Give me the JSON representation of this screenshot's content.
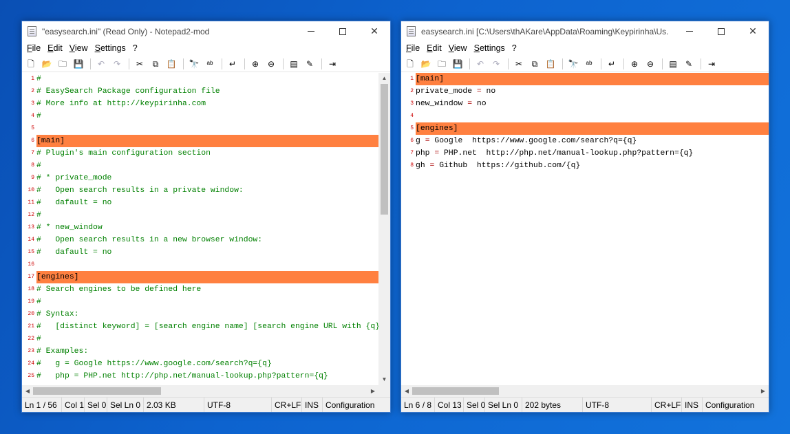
{
  "left": {
    "title": "\"easysearch.ini\" (Read Only) - Notepad2-mod",
    "menu": [
      "File",
      "Edit",
      "View",
      "Settings",
      "?"
    ],
    "lines": [
      {
        "n": "1",
        "t": "#",
        "k": "c"
      },
      {
        "n": "2",
        "t": "# EasySearch Package configuration file",
        "k": "c"
      },
      {
        "n": "3",
        "t": "# More info at http://keypirinha.com",
        "k": "c"
      },
      {
        "n": "4",
        "t": "#",
        "k": "c"
      },
      {
        "n": "5",
        "t": "",
        "k": "c"
      },
      {
        "n": "6",
        "t": "[main]",
        "k": "h"
      },
      {
        "n": "7",
        "t": "# Plugin's main configuration section",
        "k": "c"
      },
      {
        "n": "8",
        "t": "#",
        "k": "c"
      },
      {
        "n": "9",
        "t": "# * private_mode",
        "k": "c"
      },
      {
        "n": "10",
        "t": "#   Open search results in a private window:",
        "k": "c"
      },
      {
        "n": "11",
        "t": "#   dafault = no",
        "k": "c"
      },
      {
        "n": "12",
        "t": "#",
        "k": "c"
      },
      {
        "n": "13",
        "t": "# * new_window",
        "k": "c"
      },
      {
        "n": "14",
        "t": "#   Open search results in a new browser window:",
        "k": "c"
      },
      {
        "n": "15",
        "t": "#   dafault = no",
        "k": "c"
      },
      {
        "n": "16",
        "t": "",
        "k": "c"
      },
      {
        "n": "17",
        "t": "[engines]",
        "k": "h"
      },
      {
        "n": "18",
        "t": "# Search engines to be defined here",
        "k": "c"
      },
      {
        "n": "19",
        "t": "#",
        "k": "c"
      },
      {
        "n": "20",
        "t": "# Syntax:",
        "k": "c"
      },
      {
        "n": "21",
        "t": "#   [distinct keyword] = [search engine name] [search engine URL with {q}",
        "k": "c"
      },
      {
        "n": "22",
        "t": "#",
        "k": "c"
      },
      {
        "n": "23",
        "t": "# Examples:",
        "k": "c"
      },
      {
        "n": "24",
        "t": "#   g = Google https://www.google.com/search?q={q}",
        "k": "c"
      },
      {
        "n": "25",
        "t": "#   php = PHP.net http://php.net/manual-lookup.php?pattern={q}",
        "k": "c"
      }
    ],
    "status": {
      "ln": "Ln 1 / 56",
      "col": "Col 1",
      "sel": "Sel 0",
      "selln": "Sel Ln 0",
      "size": "2.03 KB",
      "enc": "UTF-8",
      "eol": "CR+LF",
      "ins": "INS",
      "scheme": "Configuration"
    }
  },
  "right": {
    "title": "easysearch.ini [C:\\Users\\thAKare\\AppData\\Roaming\\Keypirinha\\Us...",
    "menu": [
      "File",
      "Edit",
      "View",
      "Settings",
      "?"
    ],
    "lines": [
      {
        "n": "1",
        "t": "[main]",
        "k": "h"
      },
      {
        "n": "2",
        "k": "kv",
        "key": "private_mode",
        "eq": "=",
        "val": " no"
      },
      {
        "n": "3",
        "k": "kv",
        "key": "new_window",
        "eq": "=",
        "val": " no"
      },
      {
        "n": "4",
        "t": "",
        "k": "p"
      },
      {
        "n": "5",
        "t": "[engines]",
        "k": "h"
      },
      {
        "n": "6",
        "k": "kv",
        "key": "g",
        "eq": "=",
        "val": " Google  https://www.google.com/search?q={q}"
      },
      {
        "n": "7",
        "k": "kv",
        "key": "php",
        "eq": "=",
        "val": " PHP.net  http://php.net/manual-lookup.php?pattern={q}"
      },
      {
        "n": "8",
        "k": "kv",
        "key": "gh",
        "eq": "=",
        "val": " Github  https://github.com/{q}"
      }
    ],
    "status": {
      "ln": "Ln 6 / 8",
      "col": "Col 13",
      "sel": "Sel 0",
      "selln": "Sel Ln 0",
      "size": "202 bytes",
      "enc": "UTF-8",
      "eol": "CR+LF",
      "ins": "INS",
      "scheme": "Configuration"
    }
  },
  "toolbar_icons": [
    "new-file-icon",
    "open-folder-icon",
    "browse-icon",
    "save-icon",
    "sep",
    "undo-icon",
    "redo-icon",
    "sep",
    "cut-icon",
    "copy-icon",
    "paste-icon",
    "sep",
    "find-icon",
    "replace-icon",
    "sep",
    "word-wrap-icon",
    "sep",
    "zoom-in-icon",
    "zoom-out-icon",
    "sep",
    "scheme-icon",
    "customize-scheme-icon",
    "sep",
    "exit-icon"
  ],
  "toolbar_glyphs": {
    "new-file-icon": "🗋",
    "open-folder-icon": "📂",
    "browse-icon": "🗀",
    "save-icon": "💾",
    "undo-icon": "↶",
    "redo-icon": "↷",
    "cut-icon": "✂",
    "copy-icon": "⧉",
    "paste-icon": "📋",
    "find-icon": "🔭",
    "replace-icon": "ᵃᵇ",
    "word-wrap-icon": "↵",
    "zoom-in-icon": "⊕",
    "zoom-out-icon": "⊖",
    "scheme-icon": "▤",
    "customize-scheme-icon": "✎",
    "exit-icon": "⇥"
  },
  "colors": {
    "highlight": "#ff8040",
    "comment": "#008000",
    "operator": "#aa0000",
    "line_number": "#cc0000"
  }
}
